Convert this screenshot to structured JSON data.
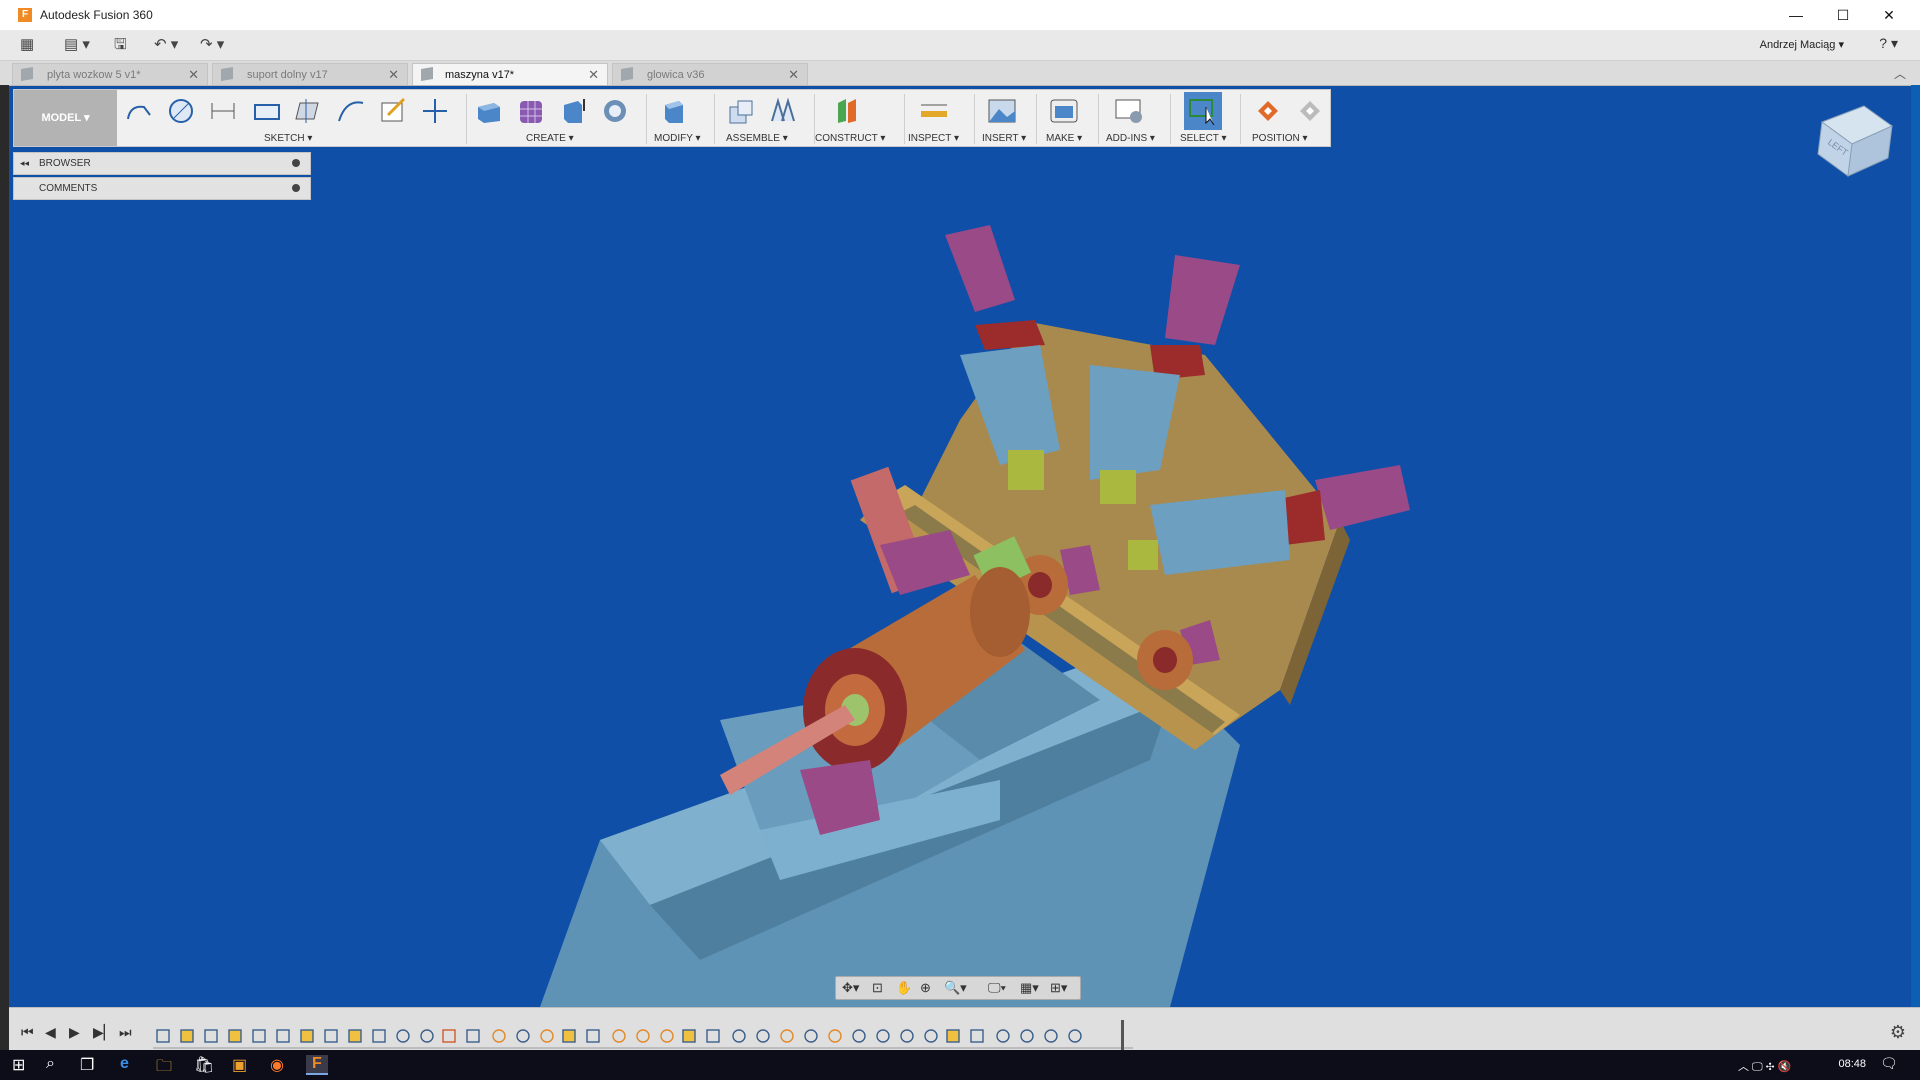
{
  "window": {
    "title": "Autodesk Fusion 360",
    "app_icon": "F",
    "minimize_icon": "—",
    "maximize_icon": "☐",
    "close_icon": "✕"
  },
  "quick_access": {
    "grid_icon": "▦",
    "file_icon": "▤ ▾",
    "save_icon": "🖫",
    "undo_icon": "↶ ▾",
    "redo_icon": "↷ ▾",
    "user": "Andrzej Maciąg ▾",
    "help_icon": "? ▾"
  },
  "tabs": [
    {
      "label": "plyta wozkow 5 v1*",
      "close": "✕",
      "active": false
    },
    {
      "label": "suport dolny v17",
      "close": "✕",
      "active": false
    },
    {
      "label": "maszyna v17*",
      "close": "✕",
      "active": true
    },
    {
      "label": "glowica v36",
      "close": "✕",
      "active": false
    }
  ],
  "tabs_scroll_icon": "︿",
  "toolbar": {
    "workspace": "MODEL ▾",
    "groups": [
      "SKETCH ▾",
      "CREATE ▾",
      "MODIFY ▾",
      "ASSEMBLE ▾",
      "CONSTRUCT ▾",
      "INSPECT ▾",
      "INSERT ▾",
      "MAKE ▾",
      "ADD-INS ▾",
      "SELECT ▾",
      "POSITION ▾"
    ]
  },
  "browser": {
    "collapse_icon": "◂◂",
    "rows": [
      "BROWSER",
      "COMMENTS"
    ]
  },
  "viewcube": {
    "face": "LEFT"
  },
  "navbar": {
    "orbit": "✥▾",
    "look": "⊡",
    "pan": "✋",
    "zoom": "⊕",
    "fit": "🔍▾",
    "display": "🖵▾",
    "grid": "▦▾",
    "viewports": "⊞▾"
  },
  "timeline": {
    "first": "⏮",
    "prev": "◀",
    "play": "▶",
    "next": "▶▏",
    "last": "⏭",
    "settings_icon": "⚙"
  },
  "taskbar": {
    "start": "⊞",
    "search": "⌕",
    "taskview": "❐",
    "edge": "e",
    "explorer": "🗀",
    "store": "🛍",
    "app1": "▣",
    "firefox": "◉",
    "fusion": "F",
    "tray": "︿  🖵  ✣  🔇",
    "time": "08:48",
    "notifications": "🗨"
  },
  "colors": {
    "viewport_bg": "#0f4fa8",
    "plate": "#a98a4e",
    "base": "#6c9fc0",
    "motor": "#9a4a86",
    "drum": "#b86c3a",
    "accent_red": "#8a2a2a"
  }
}
